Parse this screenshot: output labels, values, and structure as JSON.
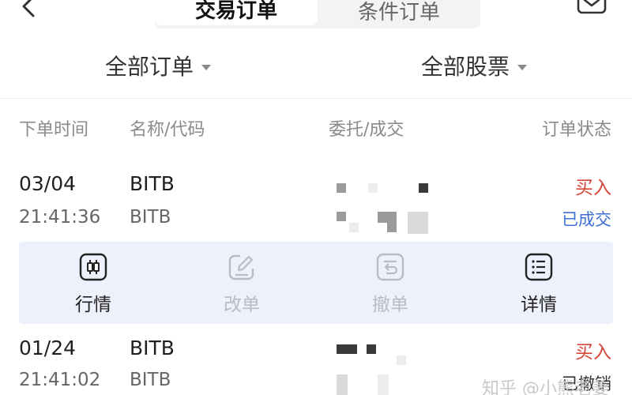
{
  "tabs": [
    {
      "label": "交易订单",
      "active": true
    },
    {
      "label": "条件订单",
      "active": false
    }
  ],
  "filters": {
    "orders": "全部订单",
    "stocks": "全部股票"
  },
  "columns": [
    "下单时间",
    "名称/代码",
    "委托/成交",
    "订单状态"
  ],
  "orders": [
    {
      "date": "03/04",
      "time": "21:41:36",
      "name": "BITB",
      "code": "BITB",
      "side": "买入",
      "status": "已成交"
    },
    {
      "date": "01/24",
      "time": "21:41:02",
      "name": "BITB",
      "code": "BITB",
      "side": "买入",
      "status": "已撤销"
    }
  ],
  "actions": [
    {
      "label": "行情",
      "enabled": true
    },
    {
      "label": "改单",
      "enabled": false
    },
    {
      "label": "撤单",
      "enabled": false
    },
    {
      "label": "详情",
      "enabled": true
    }
  ],
  "watermark": "知乎 @小熊老姜",
  "colors": {
    "buy": "#d6453b",
    "filled": "#3d6fd6",
    "panel": "#eef1fb"
  }
}
